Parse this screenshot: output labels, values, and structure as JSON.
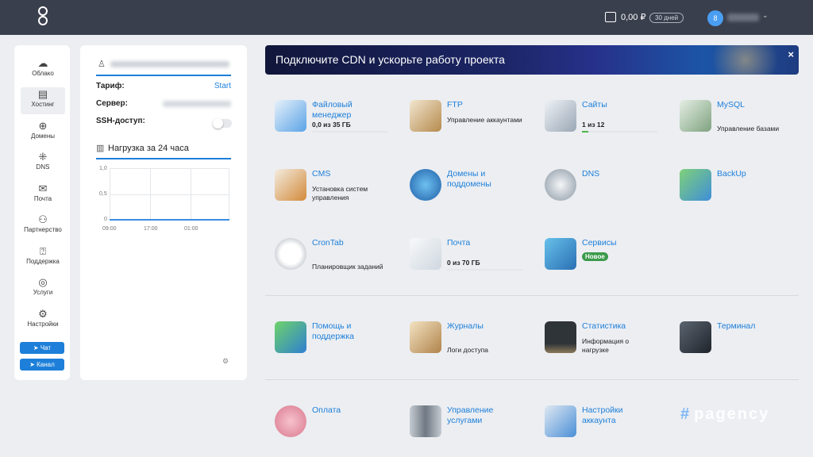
{
  "topbar": {
    "balance": "0,00 ₽",
    "days_badge": "30 дней",
    "avatar_letter": "8"
  },
  "nav": {
    "items": [
      {
        "label": "Облако",
        "icon": "cloud-icon"
      },
      {
        "label": "Хостинг",
        "icon": "server-icon"
      },
      {
        "label": "Домены",
        "icon": "globe-icon"
      },
      {
        "label": "DNS",
        "icon": "network-icon"
      },
      {
        "label": "Почта",
        "icon": "mail-icon"
      },
      {
        "label": "Партнерство",
        "icon": "partners-icon"
      },
      {
        "label": "Поддержка",
        "icon": "support-icon"
      },
      {
        "label": "Услуги",
        "icon": "services-icon"
      },
      {
        "label": "Настройки",
        "icon": "gear-icon"
      }
    ],
    "chat_label": "Чат",
    "channel_label": "Канал"
  },
  "account": {
    "tariff_label": "Тариф:",
    "tariff_value": "Start",
    "server_label": "Сервер:",
    "ssh_label": "SSH-доступ:",
    "ssh_enabled": false,
    "load_title": "Нагрузка за 24 часа"
  },
  "chart_data": {
    "type": "line",
    "title": "Нагрузка за 24 часа",
    "x_ticks": [
      "09:00",
      "17:00",
      "01:00"
    ],
    "y_ticks": [
      "1,0",
      "0,5",
      "0"
    ],
    "ylim": [
      0,
      1
    ],
    "grid": true,
    "series": [
      {
        "values": [
          0,
          0,
          0,
          0
        ]
      }
    ]
  },
  "banner": {
    "text": "Подключите CDN и ускорьте работу проекта",
    "close": "×"
  },
  "tiles": {
    "file_manager": {
      "title": "Файловый менеджер",
      "desc": "0,0 из 35 ГБ",
      "usage": 0
    },
    "ftp": {
      "title": "FTP",
      "desc": "Управление аккаунтами"
    },
    "sites": {
      "title": "Сайты",
      "desc": "1 из 12",
      "usage": 0.083
    },
    "mysql": {
      "title": "MySQL",
      "desc": "Управление базами"
    },
    "cms": {
      "title": "CMS",
      "desc": "Установка систем управления"
    },
    "domains": {
      "title": "Домены и поддомены"
    },
    "dns": {
      "title": "DNS"
    },
    "backup": {
      "title": "BackUp"
    },
    "crontab": {
      "title": "CronTab",
      "desc": "Планировщик заданий"
    },
    "mail": {
      "title": "Почта",
      "desc": "0 из 70 ГБ",
      "usage": 0
    },
    "services": {
      "title": "Сервисы",
      "badge": "Новое"
    },
    "help": {
      "title": "Помощь и поддержка"
    },
    "logs": {
      "title": "Журналы",
      "desc": "Логи доступа"
    },
    "stats": {
      "title": "Статистика",
      "desc": "Информация о нагрузке"
    },
    "terminal": {
      "title": "Терминал"
    },
    "payment": {
      "title": "Оплата"
    },
    "manage_services": {
      "title": "Управление услугами"
    },
    "account_settings": {
      "title": "Настройки аккаунта"
    }
  },
  "watermark": {
    "hash": "#",
    "text": "pagency"
  },
  "colors": {
    "accent": "#1d7fd9",
    "topbar": "#3a3f4d",
    "background": "#eceef2",
    "new_badge": "#3b9a4a"
  }
}
